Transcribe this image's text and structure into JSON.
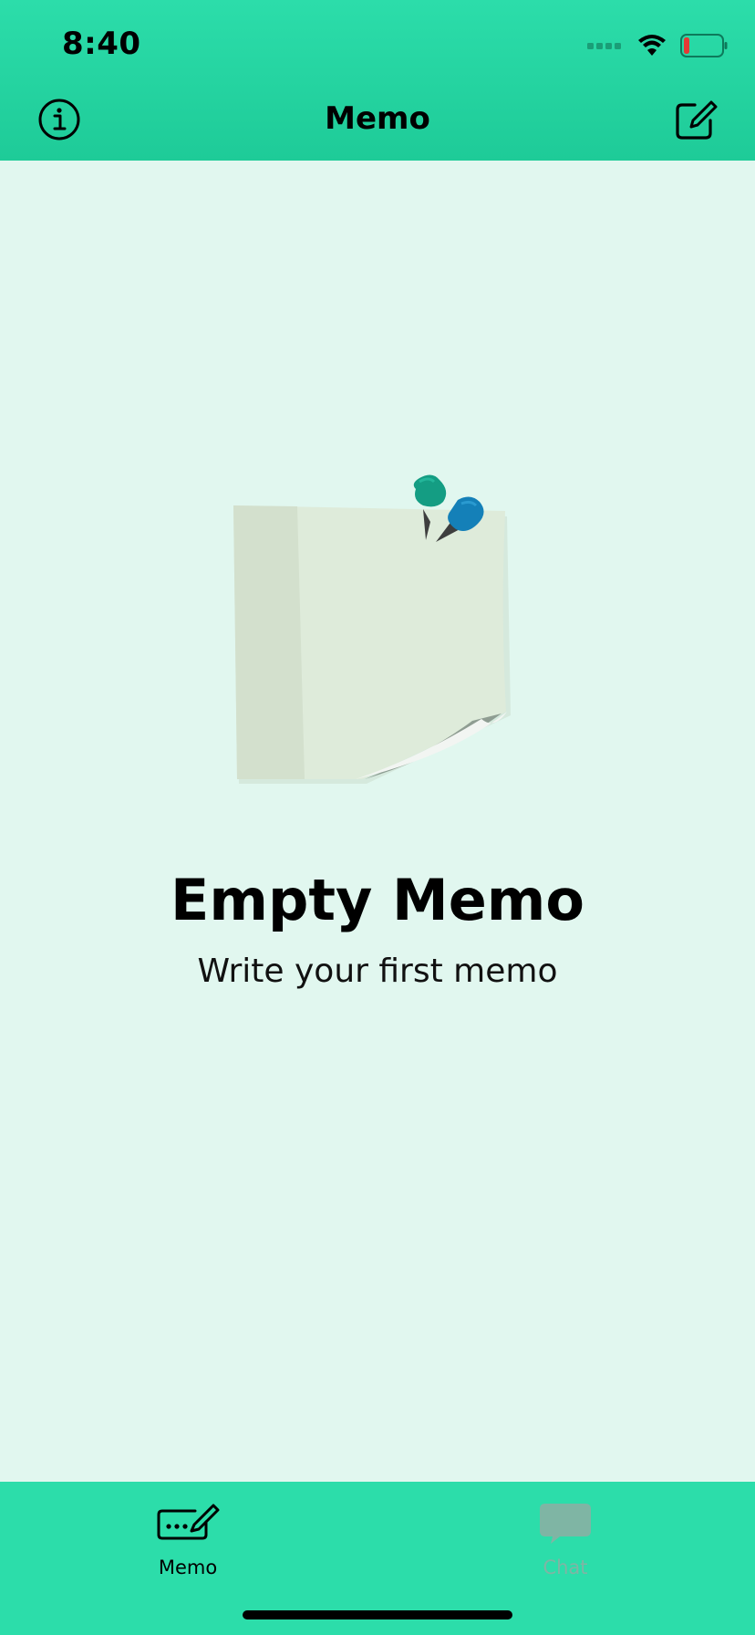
{
  "status_bar": {
    "time": "8:40",
    "icons": [
      "cellular-signal-icon",
      "wifi-icon",
      "battery-low-icon"
    ]
  },
  "nav": {
    "title": "Memo",
    "left_icon": "info-icon",
    "right_icon": "compose-icon"
  },
  "empty_state": {
    "illustration": "sticky-note-with-pins",
    "title": "Empty Memo",
    "subtitle": "Write your first memo"
  },
  "tabs": [
    {
      "label": "Memo",
      "icon": "memo-pen-icon",
      "selected": true
    },
    {
      "label": "Chat",
      "icon": "chat-bubble-icon",
      "selected": false
    }
  ],
  "colors": {
    "header": "#2CDDAA",
    "background": "#E1F7EF",
    "tab_inactive": "#7FB5A4",
    "battery_low": "#E53935"
  }
}
